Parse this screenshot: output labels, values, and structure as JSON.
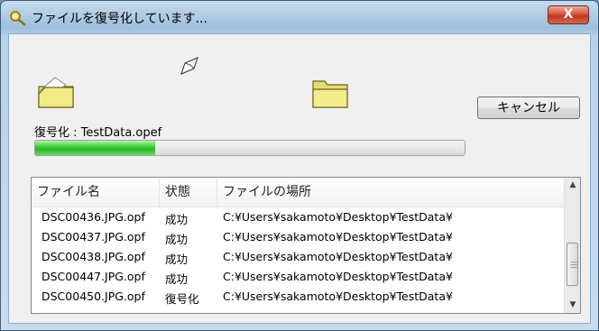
{
  "window": {
    "title": "ファイルを復号化しています...",
    "close_label": "X"
  },
  "status": {
    "label": "復号化 : TestData.opef",
    "progress": 0.28
  },
  "buttons": {
    "cancel": "キャンセル"
  },
  "list": {
    "headers": [
      "ファイル名",
      "状態",
      "ファイルの場所"
    ],
    "rows": [
      [
        "DSC00436.JPG.opf",
        "成功",
        "C:¥Users¥sakamoto¥Desktop¥TestData¥"
      ],
      [
        "DSC00437.JPG.opf",
        "成功",
        "C:¥Users¥sakamoto¥Desktop¥TestData¥"
      ],
      [
        "DSC00438.JPG.opf",
        "成功",
        "C:¥Users¥sakamoto¥Desktop¥TestData¥"
      ],
      [
        "DSC00447.JPG.opf",
        "成功",
        "C:¥Users¥sakamoto¥Desktop¥TestData¥"
      ],
      [
        "DSC00450.JPG.opf",
        "復号化",
        "C:¥Users¥sakamoto¥Desktop¥TestData¥"
      ]
    ]
  },
  "colors": {
    "progress_fill": "#2ab32a",
    "close_button": "#c13b22"
  },
  "icons": [
    "key-search-icon",
    "open-folder-icon",
    "flying-paper-icon",
    "folder-icon"
  ]
}
